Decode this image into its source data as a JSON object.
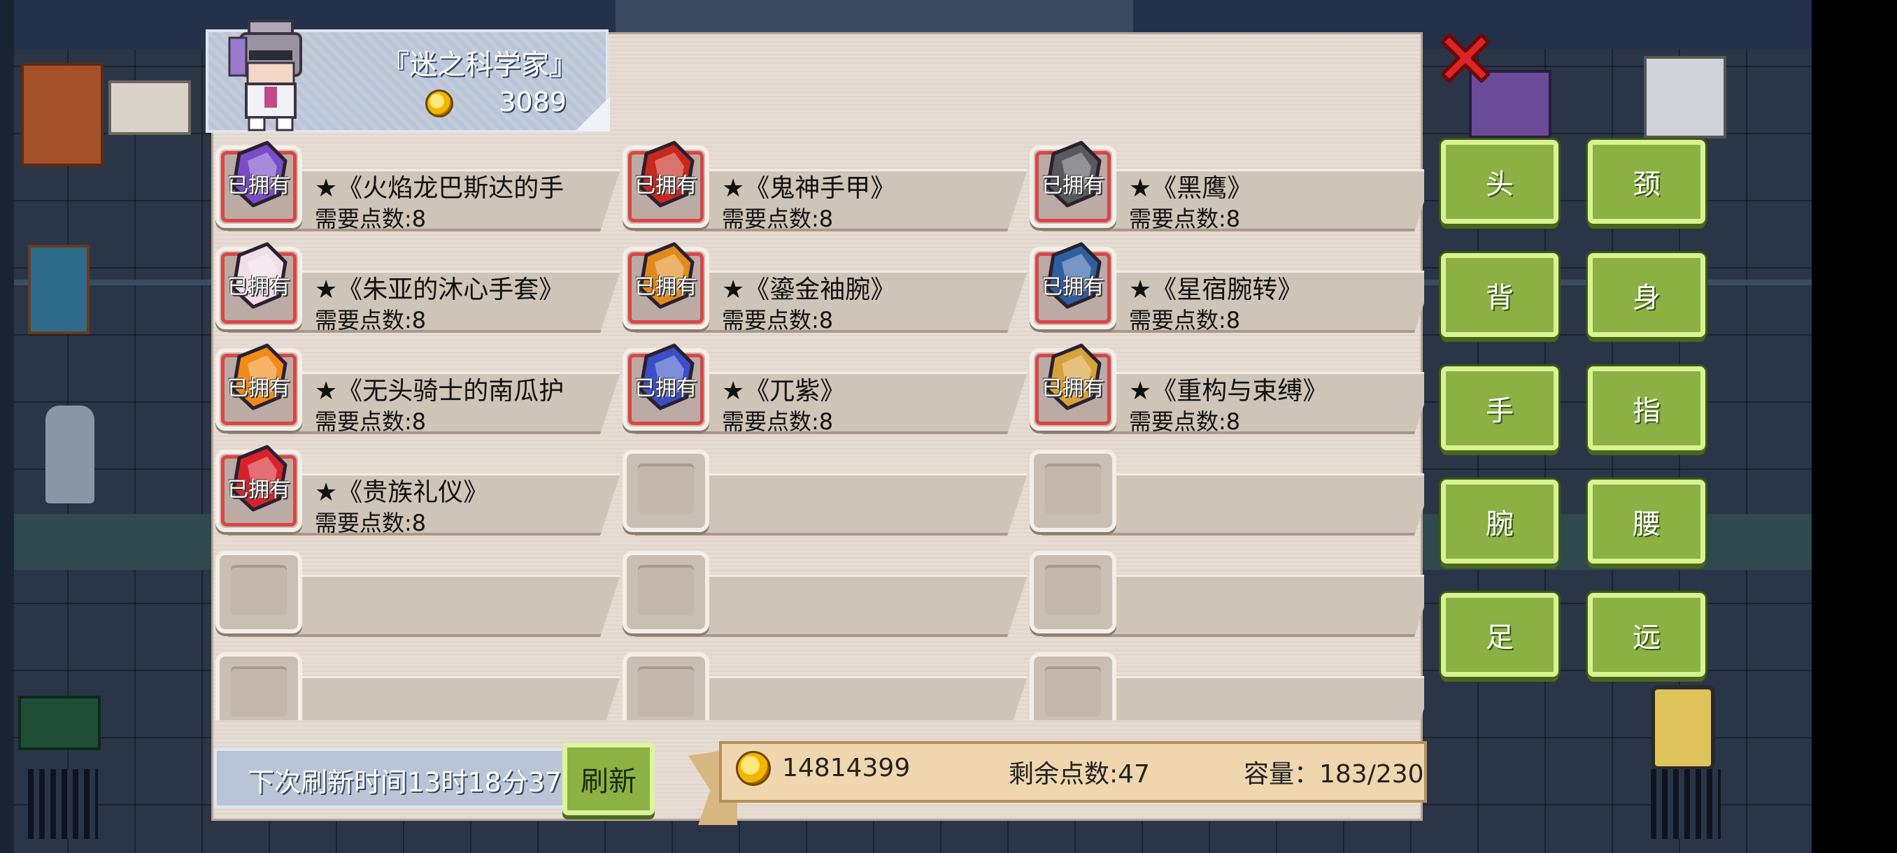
{
  "header": {
    "title": "『迷之科学家』",
    "coins": "3089"
  },
  "owned_label": "已拥有",
  "items": [
    {
      "name": "★《火焰龙巴斯达的手",
      "cost": "需要点数:8",
      "owned": true,
      "icon": "purple-gauntlet-icon",
      "color": "#7a4cc8"
    },
    {
      "name": "★《鬼神手甲》",
      "cost": "需要点数:8",
      "owned": true,
      "icon": "demon-gauntlet-icon",
      "color": "#c8281e"
    },
    {
      "name": "★《黑鹰》",
      "cost": "需要点数:8",
      "owned": true,
      "icon": "black-hawk-icon",
      "color": "#5a5a5e"
    },
    {
      "name": "★《朱亚的沐心手套》",
      "cost": "需要点数:8",
      "owned": true,
      "icon": "white-glove-icon",
      "color": "#f0dde6"
    },
    {
      "name": "★《鎏金袖腕》",
      "cost": "需要点数:8",
      "owned": true,
      "icon": "gold-bracer-icon",
      "color": "#e08a1c"
    },
    {
      "name": "★《星宿腕转》",
      "cost": "需要点数:8",
      "owned": true,
      "icon": "star-bracer-icon",
      "color": "#2f5fa0"
    },
    {
      "name": "★《无头骑士的南瓜护",
      "cost": "需要点数:8",
      "owned": true,
      "icon": "pumpkin-icon",
      "color": "#f28a18"
    },
    {
      "name": "★《兀紫》",
      "cost": "需要点数:8",
      "owned": true,
      "icon": "blue-claw-icon",
      "color": "#3a4fc8"
    },
    {
      "name": "★《重构与束缚》",
      "cost": "需要点数:8",
      "owned": true,
      "icon": "golden-armor-icon",
      "color": "#d8a23a"
    },
    {
      "name": "★《贵族礼仪》",
      "cost": "需要点数:8",
      "owned": true,
      "icon": "rose-glove-icon",
      "color": "#d8232a"
    },
    {
      "name": "",
      "cost": "",
      "owned": false
    },
    {
      "name": "",
      "cost": "",
      "owned": false
    },
    {
      "name": "",
      "cost": "",
      "owned": false
    },
    {
      "name": "",
      "cost": "",
      "owned": false
    },
    {
      "name": "",
      "cost": "",
      "owned": false
    },
    {
      "name": "",
      "cost": "",
      "owned": false
    },
    {
      "name": "",
      "cost": "",
      "owned": false
    },
    {
      "name": "",
      "cost": "",
      "owned": false
    }
  ],
  "footer": {
    "refresh_time": "下次刷新时间13时18分37",
    "refresh_button": "刷新",
    "gold": "14814399",
    "points": "剩余点数:47",
    "capacity": "容量：183/230"
  },
  "categories": [
    "头",
    "颈",
    "背",
    "身",
    "手",
    "指",
    "腕",
    "腰",
    "足",
    "远"
  ],
  "colors": {
    "button_green": "#8bb043",
    "close_red": "#e02424",
    "owned_red": "#d94646"
  }
}
